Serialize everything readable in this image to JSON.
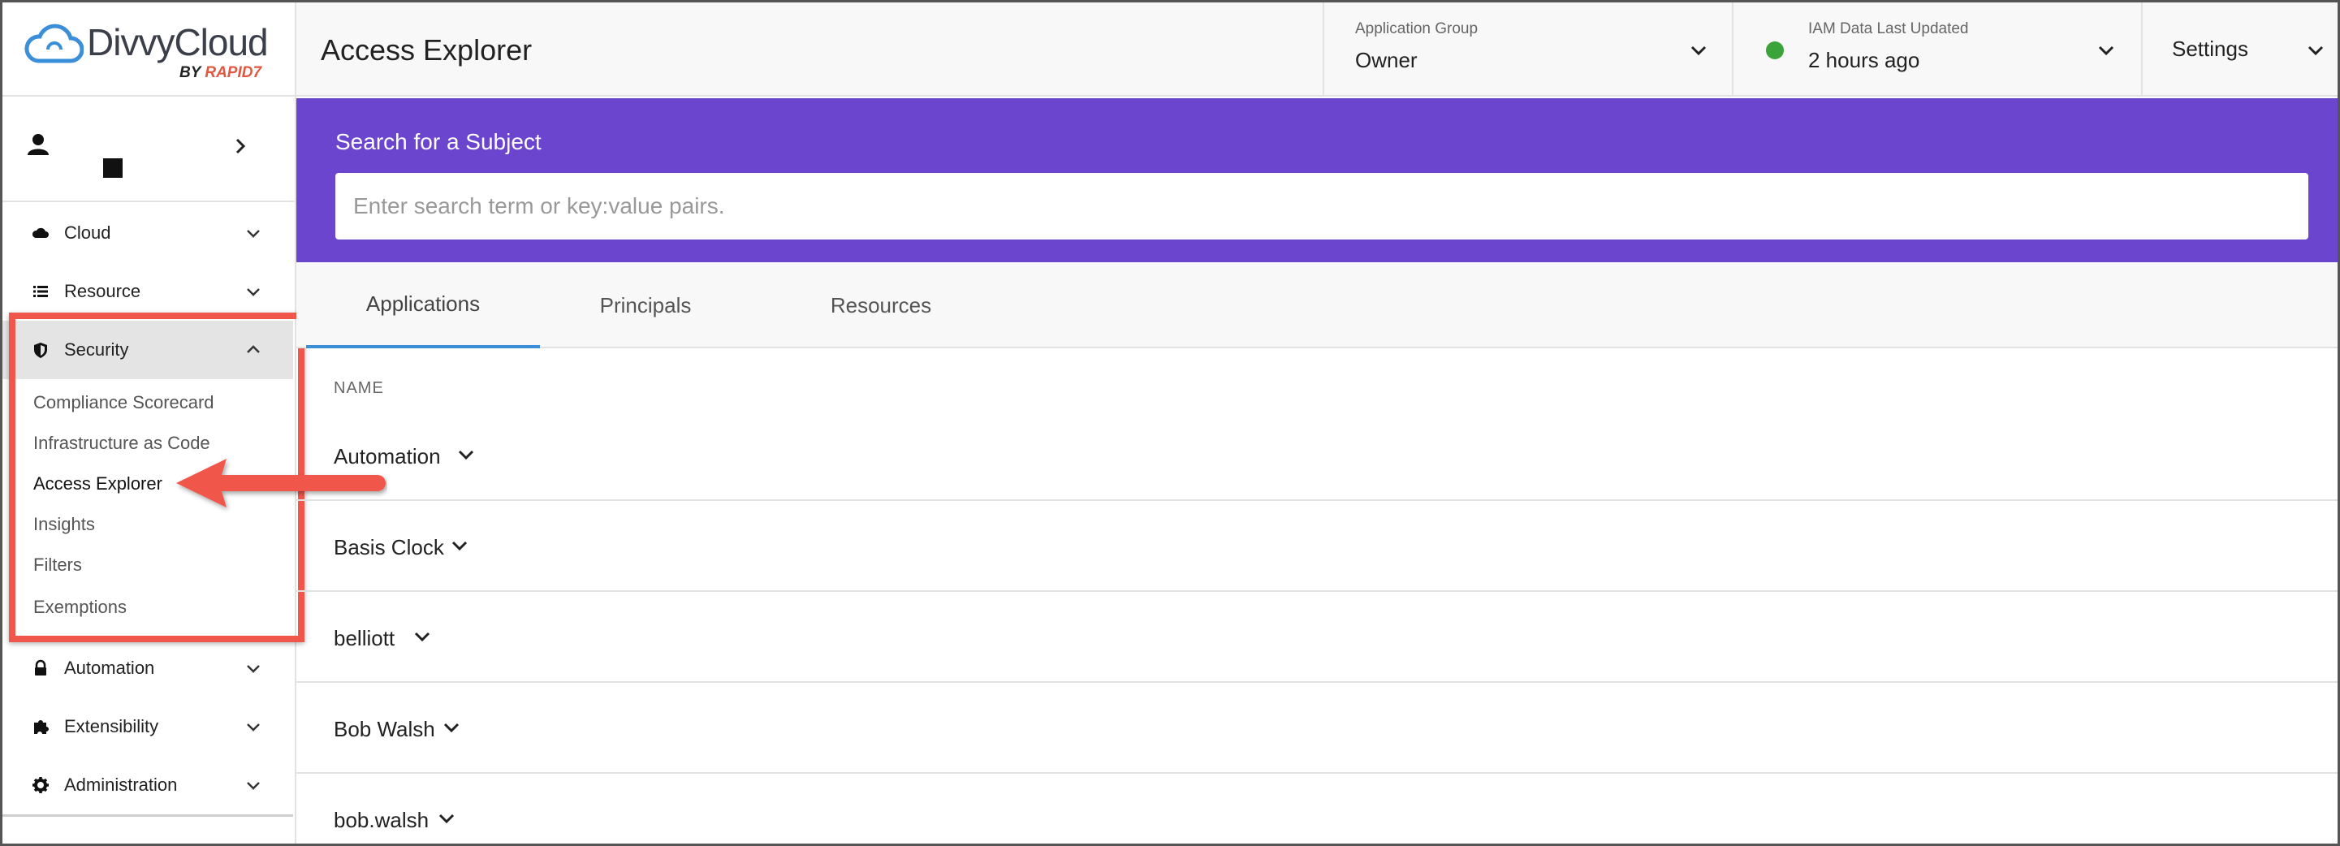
{
  "logo": {
    "name": "DivvyCloud",
    "by": "BY",
    "brand": "RAPID7"
  },
  "header": {
    "title": "Access Explorer",
    "application_group": {
      "label": "Application Group",
      "value": "Owner"
    },
    "iam": {
      "label": "IAM Data Last Updated",
      "value": "2 hours ago",
      "status_color": "#3aa33a"
    },
    "settings": {
      "label": "Settings"
    }
  },
  "sidebar": {
    "items": [
      {
        "label": "Cloud",
        "icon": "cloud-icon"
      },
      {
        "label": "Resource",
        "icon": "list-icon"
      },
      {
        "label": "Security",
        "icon": "shield-icon",
        "expanded": true
      },
      {
        "label": "Automation",
        "icon": "lock-icon"
      },
      {
        "label": "Extensibility",
        "icon": "puzzle-icon"
      },
      {
        "label": "Administration",
        "icon": "gear-icon"
      }
    ],
    "security_sub": [
      "Compliance Scorecard",
      "Infrastructure as Code",
      "Access Explorer",
      "Insights",
      "Filters",
      "Exemptions"
    ]
  },
  "search": {
    "title": "Search for a Subject",
    "placeholder": "Enter search term or key:value pairs.",
    "value": ""
  },
  "tabs": [
    {
      "label": "Applications",
      "active": true
    },
    {
      "label": "Principals",
      "active": false
    },
    {
      "label": "Resources",
      "active": false
    }
  ],
  "table": {
    "column": "NAME",
    "rows": [
      "Automation",
      "Basis Clock",
      "belliott",
      "Bob Walsh",
      "bob.walsh"
    ]
  },
  "colors": {
    "accent": "#6b45cd",
    "tab_active": "#3a8fd8",
    "callout": "#f0574a"
  }
}
